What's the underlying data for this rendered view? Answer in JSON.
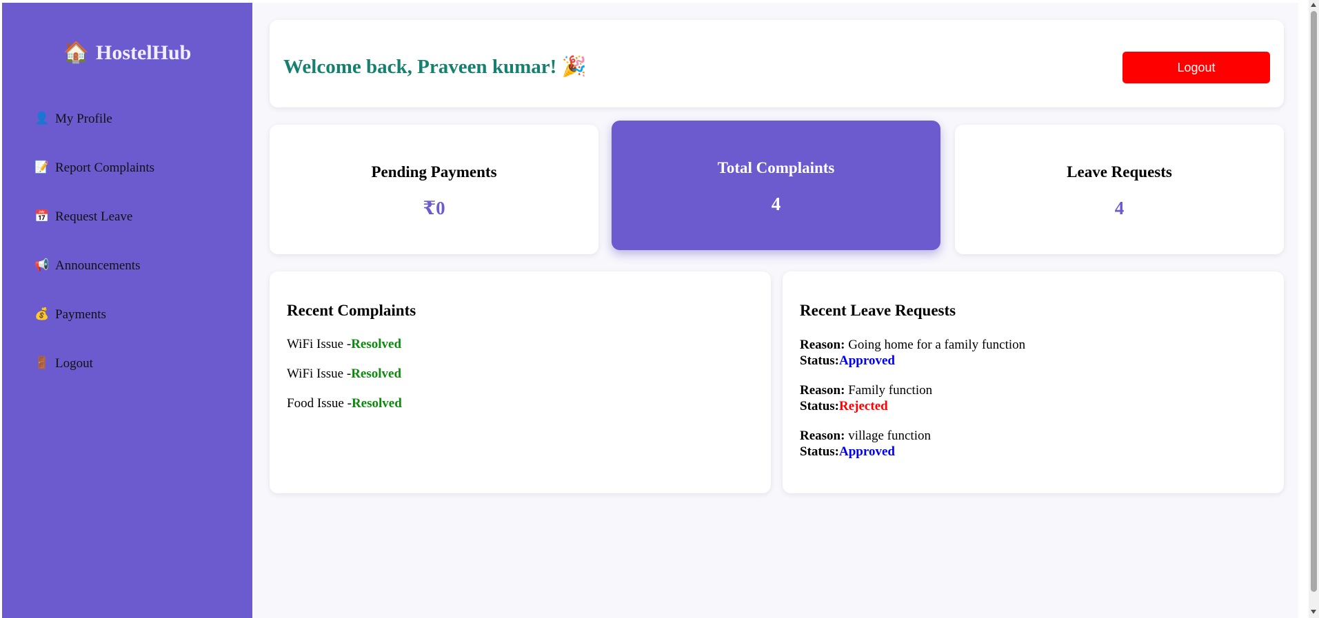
{
  "brand": {
    "icon": "🏠",
    "name": "HostelHub"
  },
  "sidebar": {
    "items": [
      {
        "icon": "👤",
        "icon_name": "user-icon",
        "label": "My Profile"
      },
      {
        "icon": "📝",
        "icon_name": "memo-icon",
        "label": "Report Complaints"
      },
      {
        "icon": "📅",
        "icon_name": "calendar-icon",
        "label": "Request Leave"
      },
      {
        "icon": "📢",
        "icon_name": "megaphone-icon",
        "label": "Announcements"
      },
      {
        "icon": "💰",
        "icon_name": "money-bag-icon",
        "label": "Payments"
      },
      {
        "icon": "🚪",
        "icon_name": "door-icon",
        "label": "Logout"
      }
    ]
  },
  "header": {
    "welcome": "Welcome back, Praveen kumar! 🎉",
    "logout_label": "Logout"
  },
  "stats": [
    {
      "title": "Pending Payments",
      "value": "₹0"
    },
    {
      "title": "Total Complaints",
      "value": "4"
    },
    {
      "title": "Leave Requests",
      "value": "4"
    }
  ],
  "complaints": {
    "title": "Recent Complaints",
    "items": [
      {
        "name": "WiFi Issue",
        "separator": " -",
        "status": "Resolved"
      },
      {
        "name": "WiFi Issue",
        "separator": " -",
        "status": "Resolved"
      },
      {
        "name": "Food Issue",
        "separator": " -",
        "status": "Resolved"
      }
    ]
  },
  "leaves": {
    "title": "Recent Leave Requests",
    "reason_label": "Reason:",
    "status_label": "Status:",
    "items": [
      {
        "reason": "Going home for a family function",
        "status": "Approved"
      },
      {
        "reason": "Family function",
        "status": "Rejected"
      },
      {
        "reason": "village function",
        "status": "Approved"
      }
    ]
  },
  "colors": {
    "accent": "#6c5bcf",
    "welcome": "#15806e",
    "logout": "#ff0000",
    "resolved": "#0b8a0b",
    "approved": "#0000ee",
    "rejected": "#ff0000"
  }
}
